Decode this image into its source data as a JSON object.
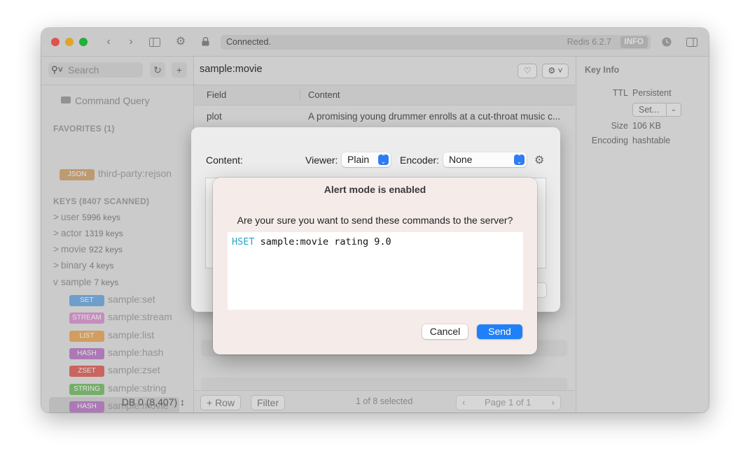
{
  "toolbar": {
    "status": "Connected.",
    "server_version": "Redis 6.2.7",
    "info_label": "INFO"
  },
  "sidebar": {
    "search_placeholder": "Search",
    "command_query": "Command Query",
    "favorites_header": "FAVORITES (1)",
    "favorites": [
      {
        "type": "JSON",
        "name": "third-party:rejson",
        "color": "#d9b080"
      }
    ],
    "keys_header": "KEYS (8407 SCANNED)",
    "groups": [
      {
        "chevron": ">",
        "name": "user",
        "count": "5996 keys"
      },
      {
        "chevron": ">",
        "name": "actor",
        "count": "1319 keys"
      },
      {
        "chevron": ">",
        "name": "movie",
        "count": "922 keys"
      },
      {
        "chevron": ">",
        "name": "binary",
        "count": "4 keys"
      },
      {
        "chevron": "v",
        "name": "sample",
        "count": "7 keys"
      }
    ],
    "sample_keys": [
      {
        "type": "SET",
        "name": "sample:set",
        "color": "#7fb4e8"
      },
      {
        "type": "STREAM",
        "name": "sample:stream",
        "color": "#e2a0d8"
      },
      {
        "type": "LIST",
        "name": "sample:list",
        "color": "#eeb46d"
      },
      {
        "type": "HASH",
        "name": "sample:hash",
        "color": "#c48ad0"
      },
      {
        "type": "ZSET",
        "name": "sample:zset",
        "color": "#e6726c"
      },
      {
        "type": "STRING",
        "name": "sample:string",
        "color": "#86c877"
      },
      {
        "type": "HASH",
        "name": "sample:movie",
        "color": "#c48ad0"
      }
    ],
    "db_selector": "DB 0 (8,407) ↕"
  },
  "main": {
    "key_name": "sample:movie",
    "columns": {
      "field": "Field",
      "content": "Content"
    },
    "rows": [
      {
        "field": "plot",
        "content": "A promising young drummer enrolls at a cut-throat music c..."
      }
    ],
    "footer": {
      "add_row": "+ Row",
      "filter": "Filter",
      "selection": "1 of 8 selected",
      "page": "Page 1 of 1"
    }
  },
  "key_info": {
    "title": "Key Info",
    "ttl_label": "TTL",
    "ttl_value": "Persistent",
    "set_button": "Set...",
    "size_label": "Size",
    "size_value": "106 KB",
    "encoding_label": "Encoding",
    "encoding_value": "hashtable"
  },
  "edit_sheet": {
    "content_label": "Content:",
    "viewer_label": "Viewer:",
    "viewer_value": "Plain",
    "encoder_label": "Encoder:",
    "encoder_value": "None"
  },
  "alert": {
    "title": "Alert mode is enabled",
    "message": "Are your sure you want to send these commands to the server?",
    "command_keyword": "HSET",
    "command_rest": " sample:movie rating 9.0",
    "cancel_label": "Cancel",
    "send_label": "Send"
  }
}
